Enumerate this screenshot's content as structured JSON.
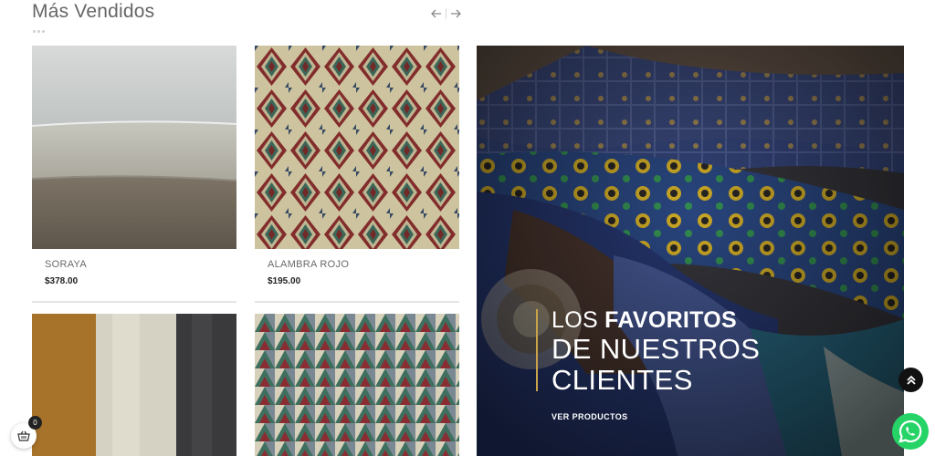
{
  "section": {
    "title": "Más Vendidos"
  },
  "nav": {
    "prev_icon": "arrow-left-icon",
    "next_icon": "arrow-right-icon"
  },
  "products": [
    {
      "name": "SORAYA",
      "price": "$378.00",
      "image": "grey-brown-fabric-rolls"
    },
    {
      "name": "ALAMBRA ROJO",
      "price": "$195.00",
      "image": "diamond-pattern-tapestry"
    },
    {
      "name": "",
      "price": "",
      "image": "suede-fabric-rolls"
    },
    {
      "name": "",
      "price": "",
      "image": "triangle-pattern-tapestry"
    }
  ],
  "banner": {
    "line1_regular": "LOS ",
    "line1_bold": "FAVORITOS",
    "line2": "DE NUESTROS",
    "line3": "CLIENTES",
    "cta": "VER PRODUCTOS",
    "accent_color": "#c9a24a"
  },
  "floating": {
    "scroll_top_icon": "double-chevron-up-icon",
    "whatsapp_icon": "whatsapp-icon",
    "cart_icon": "cart-icon",
    "cart_count": "0"
  }
}
